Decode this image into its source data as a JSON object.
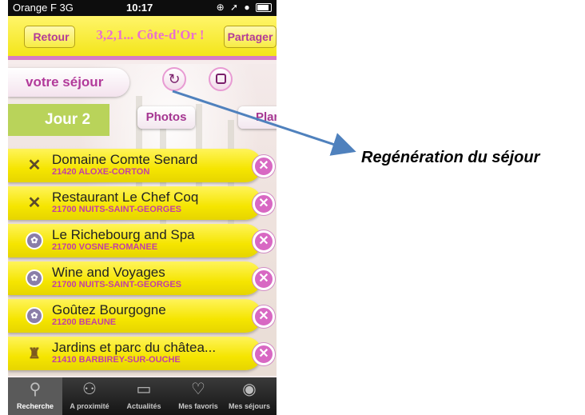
{
  "status_bar": {
    "carrier": "Orange F  3G",
    "time": "10:17"
  },
  "nav": {
    "back_label": "Retour",
    "title": "3,2,1... Côte-d'Or !",
    "share_label": "Partager"
  },
  "toolbar": {
    "sejour_label": "votre séjour",
    "regen_icon": "refresh-icon",
    "save_icon": "save-icon"
  },
  "day": {
    "label": "Jour 2",
    "photos_label": "Photos",
    "plan_label": "Plan"
  },
  "items": [
    {
      "name": "Domaine Comte Senard",
      "address": "21420 ALOXE-CORTON",
      "icon": "restaurant-icon"
    },
    {
      "name": "Restaurant Le Chef Coq",
      "address": "21700 NUITS-SAINT-GEORGES",
      "icon": "restaurant-icon"
    },
    {
      "name": "Le Richebourg and Spa",
      "address": "21700 VOSNE-ROMANEE",
      "icon": "activity-icon"
    },
    {
      "name": "Wine and Voyages",
      "address": "21700 NUITS-SAINT-GEORGES",
      "icon": "activity-icon"
    },
    {
      "name": "Goûtez Bourgogne",
      "address": "21200 BEAUNE",
      "icon": "activity-icon"
    },
    {
      "name": "Jardins et parc du châtea...",
      "address": "21410 BARBIREY-SUR-OUCHE",
      "icon": "castle-icon"
    }
  ],
  "tabs": [
    {
      "label": "Recherche",
      "icon": "search-icon",
      "active": true
    },
    {
      "label": "A proximité",
      "icon": "location-icon",
      "active": false
    },
    {
      "label": "Actualités",
      "icon": "book-icon",
      "active": false
    },
    {
      "label": "Mes favoris",
      "icon": "heart-icon",
      "active": false
    },
    {
      "label": "Mes séjours",
      "icon": "eye-icon",
      "active": false
    }
  ],
  "annotation": {
    "text": "Regénération du séjour",
    "color": "#4f81bd"
  },
  "colors": {
    "accent_pink": "#d868c3",
    "item_yellow": "#f5e500",
    "day_green": "#b9d35a"
  }
}
